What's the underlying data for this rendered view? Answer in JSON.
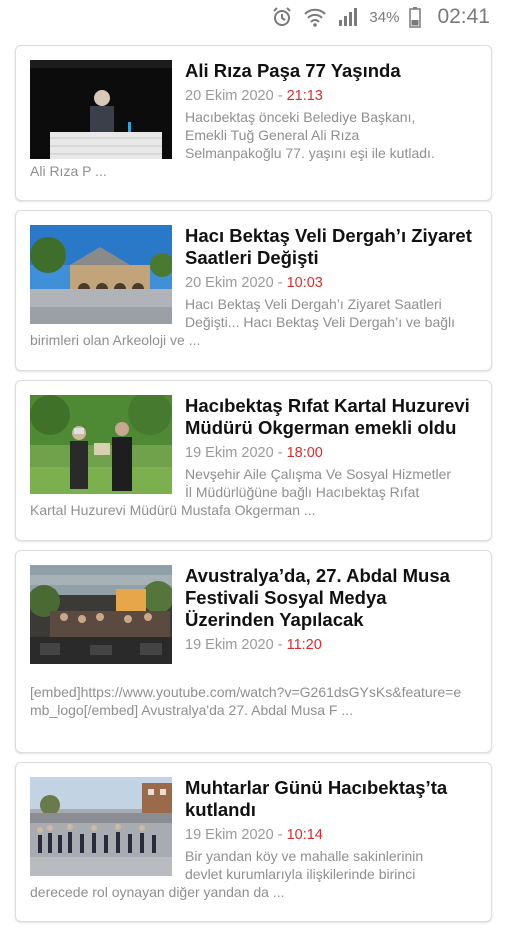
{
  "status_bar": {
    "battery_percent": "34%",
    "time": "02:41",
    "icons": [
      "alarm-icon",
      "wifi-icon",
      "signal-icon",
      "battery-icon"
    ]
  },
  "articles": [
    {
      "title": "Ali Rıza Paşa 77 Yaşında",
      "date": "20 Ekim 2020",
      "separator": "-",
      "time": "21:13",
      "excerpt_lines": [
        "Hacıbektaş önceki Belediye Başkanı,",
        "Emekli Tuğ General Ali Rıza",
        "Selmanpakoğlu 77. yaşını eşi ile kutladı."
      ],
      "excerpt_full": "Ali Rıza P ..."
    },
    {
      "title": "Hacı Bektaş Veli Dergah’ı Ziyaret Saatleri Değişti",
      "date": "20 Ekim 2020",
      "separator": "-",
      "time": "10:03",
      "excerpt_lines": [
        "Hacı Bektaş Veli Dergah’ı Ziyaret Saatleri",
        "Değişti... Hacı Bektaş Veli Dergah’ı ve bağlı"
      ],
      "excerpt_full": "birimleri olan Arkeoloji ve ..."
    },
    {
      "title": "Hacıbektaş Rıfat Kartal Huzurevi Müdürü Okgerman emekli oldu",
      "date": "19 Ekim 2020",
      "separator": "-",
      "time": "18:00",
      "excerpt_lines": [
        "Nevşehir Aile Çalışma Ve Sosyal Hizmetler",
        "İl Müdürlüğüne bağlı Hacıbektaş Rıfat"
      ],
      "excerpt_full": "Kartal Huzurevi Müdürü Mustafa Okgerman ..."
    },
    {
      "title": "Avustralya’da, 27. Abdal Musa Festivali Sosyal Medya Üzerinden Yapılacak",
      "date": "19 Ekim 2020",
      "separator": "-",
      "time": "11:20",
      "excerpt_lines": [],
      "excerpt_full": "[embed]https://www.youtube.com/watch?v=G261dsGYsKs&feature=emb_logo[/embed] Avustralya'da 27. Abdal Musa F ..."
    },
    {
      "title": "Muhtarlar Günü Hacıbektaş’ta kutlandı",
      "date": "19 Ekim 2020",
      "separator": "-",
      "time": "10:14",
      "excerpt_lines": [
        "Bir yandan köy ve mahalle sakinlerinin",
        "devlet kurumlarıyla ilişkilerinde birinci"
      ],
      "excerpt_full": "derecede rol oynayan diğer yandan da ..."
    }
  ]
}
